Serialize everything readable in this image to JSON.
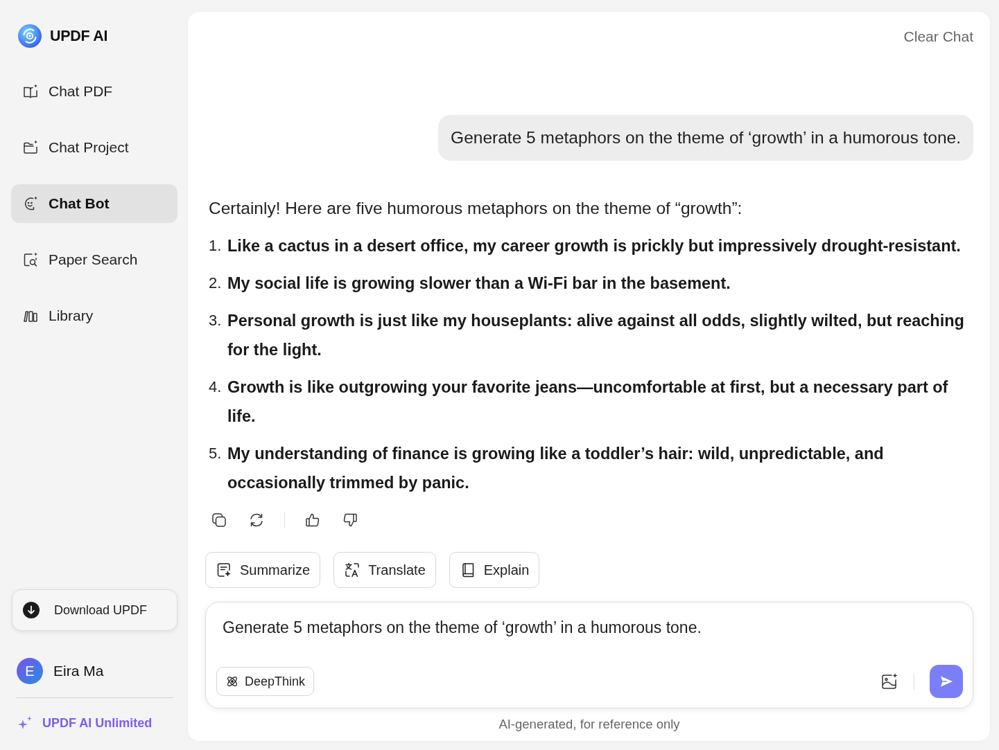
{
  "sidebar": {
    "brand": "UPDF AI",
    "nav_items": [
      {
        "label": "Chat PDF",
        "selected": false
      },
      {
        "label": "Chat Project",
        "selected": false
      },
      {
        "label": "Chat Bot",
        "selected": true
      },
      {
        "label": "Paper Search",
        "selected": false
      },
      {
        "label": "Library",
        "selected": false
      }
    ],
    "download_button": "Download UPDF",
    "user": {
      "initial": "E",
      "name": "Eira Ma"
    },
    "upgrade_link": "UPDF AI Unlimited"
  },
  "chat": {
    "clear_button": "Clear Chat",
    "user_message": "Generate 5 metaphors on the theme of ‘growth’ in a humorous tone.",
    "response": {
      "intro": "Certainly! Here are five humorous metaphors on the theme of “growth”:",
      "items": [
        {
          "number": "1.",
          "text": "Like a cactus in a desert office, my career growth is prickly but impressively drought-resistant."
        },
        {
          "number": "2.",
          "text": "My social life is growing slower than a Wi-Fi bar in the basement."
        },
        {
          "number": "3.",
          "text": "Personal growth is just like my houseplants: alive against all odds, slightly wilted, but reaching for the light."
        },
        {
          "number": "4.",
          "text": "Growth is like outgrowing your favorite jeans—uncomfortable at first, but a necessary part of life."
        },
        {
          "number": "5.",
          "text": "My understanding of finance is growing like a toddler’s hair: wild, unpredictable, and occasionally trimmed by panic."
        }
      ]
    },
    "quick_actions": [
      "Summarize",
      "Translate",
      "Explain"
    ],
    "composer": {
      "value": "Generate 5 metaphors on the theme of ‘growth’ in a humorous tone.",
      "deepthink_button": "DeepThink"
    },
    "footer_note": "AI-generated, for reference only"
  }
}
